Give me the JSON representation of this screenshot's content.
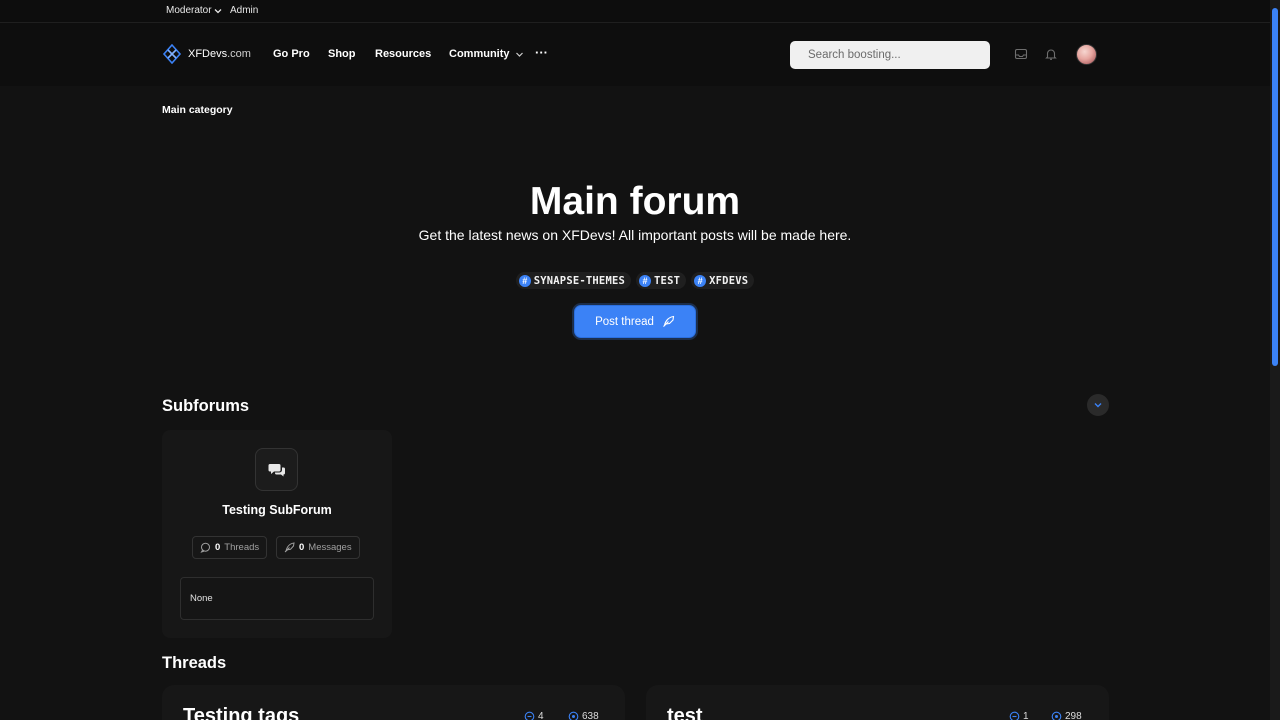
{
  "topbar": {
    "moderator_label": "Moderator",
    "admin_label": "Admin"
  },
  "navbar": {
    "logo_name": "XFDevs",
    "logo_suffix": ".com",
    "links": [
      "Go Pro",
      "Shop",
      "Resources",
      "Community"
    ],
    "more_label": "···",
    "search_placeholder": "Search boosting..."
  },
  "breadcrumb": "Main category",
  "hero": {
    "title": "Main forum",
    "description": "Get the latest news on XFDevs! All important posts will be made here.",
    "tags": [
      "SYNAPSE-THEMES",
      "TEST",
      "XFDEVS"
    ],
    "tag_symbol": "#",
    "post_button_label": "Post thread"
  },
  "subforums": {
    "section_title": "Subforums",
    "items": [
      {
        "title": "Testing SubForum",
        "threads_count": "0",
        "threads_label": "Threads",
        "messages_count": "0",
        "messages_label": "Messages",
        "last_post": "None"
      }
    ]
  },
  "threads": {
    "section_title": "Threads",
    "items": [
      {
        "title": "Testing tags",
        "replies": "4",
        "views": "638"
      },
      {
        "title": "test",
        "replies": "1",
        "views": "298"
      }
    ]
  },
  "colors": {
    "accent": "#3b82f6",
    "background": "#121212",
    "card": "#171717"
  }
}
